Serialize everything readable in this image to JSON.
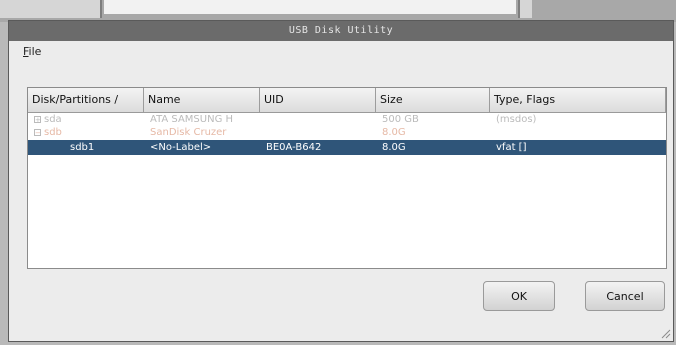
{
  "window": {
    "title": "USB Disk Utility"
  },
  "menu": {
    "file_mnemonic": "F",
    "file_rest": "ile"
  },
  "table": {
    "headers": [
      "Disk/Partitions /",
      "Name",
      "UID",
      "Size",
      "Type, Flags"
    ],
    "rows": [
      {
        "disk": "sda",
        "name": "ATA SAMSUNG H",
        "uid": "",
        "size": "500 GB",
        "type": "(msdos)"
      },
      {
        "disk": "sdb",
        "name": "SanDisk Cruzer",
        "uid": "",
        "size": "8.0G",
        "type": ""
      },
      {
        "disk": "sdb1",
        "name": "<No-Label>",
        "uid": "BE0A-B642",
        "size": "8.0G",
        "type": "vfat []"
      }
    ]
  },
  "buttons": {
    "ok": "OK",
    "cancel": "Cancel"
  },
  "colors": {
    "selection": "#2f5579",
    "titlebar": "#6b6b6b"
  }
}
